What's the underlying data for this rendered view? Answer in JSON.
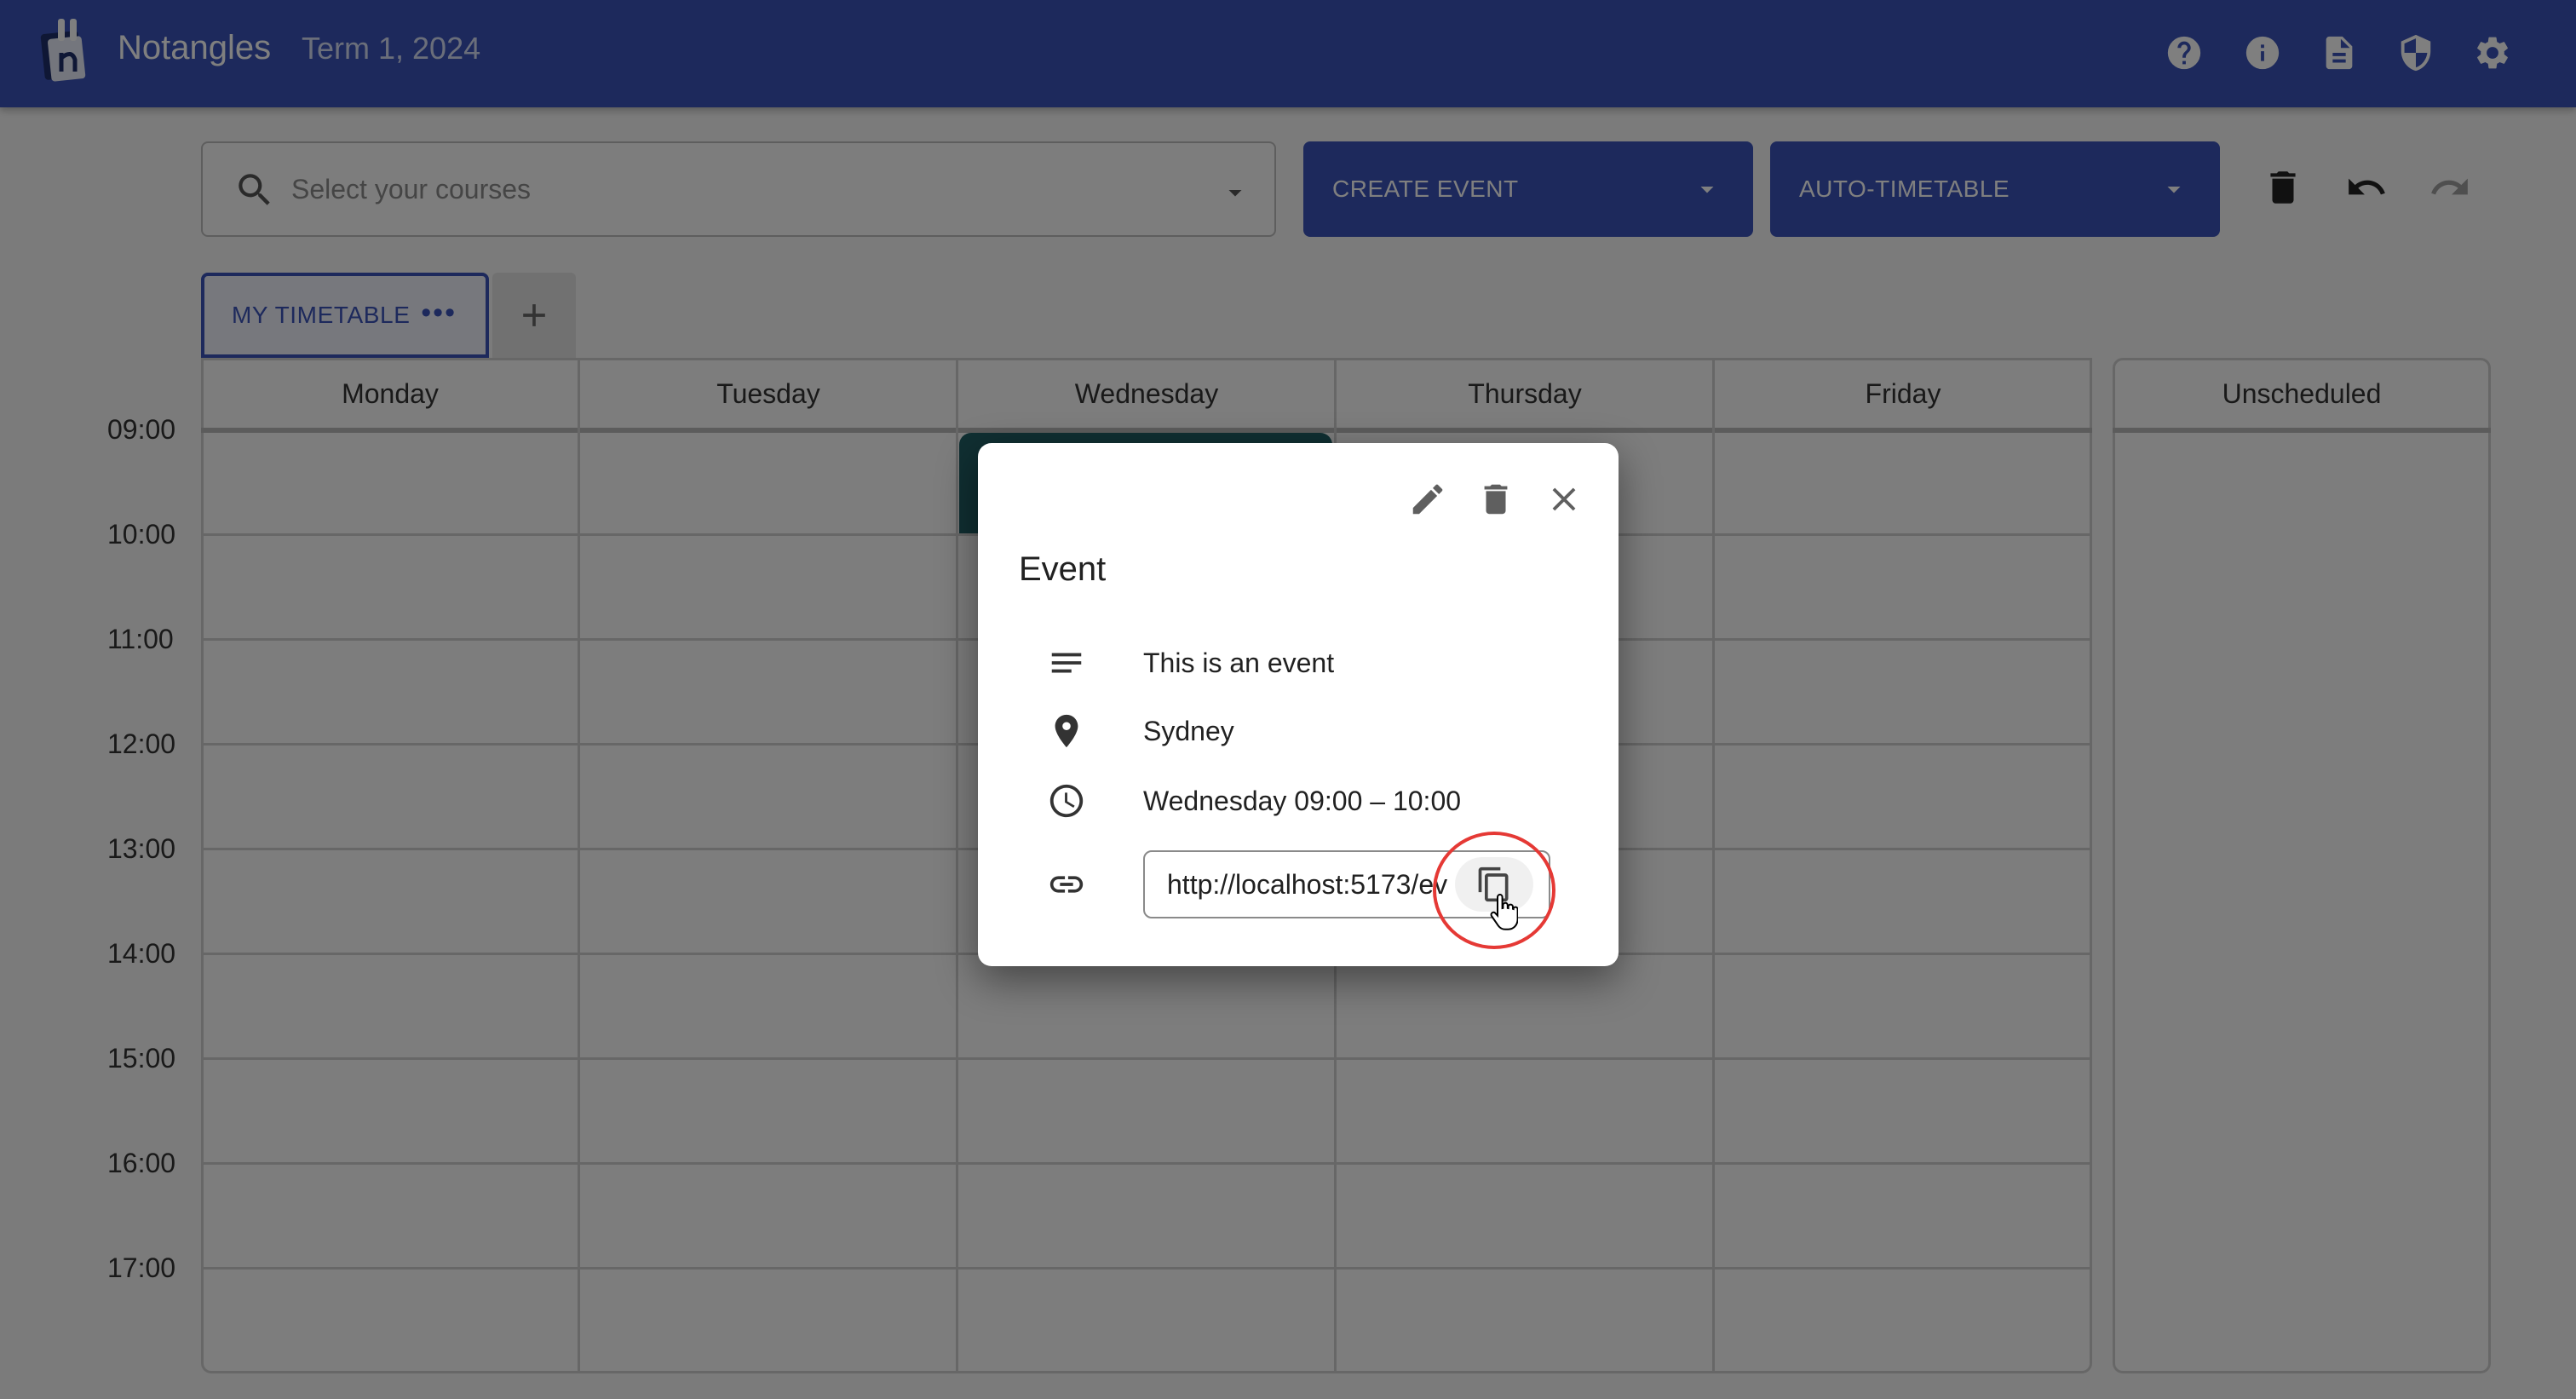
{
  "header": {
    "app_name": "Notangles",
    "term": "Term 1, 2024",
    "icons": [
      "help-icon",
      "info-icon",
      "document-icon",
      "shield-icon",
      "gear-icon"
    ]
  },
  "controls": {
    "course_select_placeholder": "Select your courses",
    "create_event_label": "CREATE EVENT",
    "auto_timetable_label": "AUTO-TIMETABLE",
    "tool_icons": [
      "delete-icon",
      "undo-icon",
      "redo-icon"
    ]
  },
  "tabs": {
    "active_label": "MY TIMETABLE",
    "more_label": "•••"
  },
  "timetable": {
    "days": [
      "Monday",
      "Tuesday",
      "Wednesday",
      "Thursday",
      "Friday"
    ],
    "unscheduled_label": "Unscheduled",
    "times": [
      "09:00",
      "10:00",
      "11:00",
      "12:00",
      "13:00",
      "14:00",
      "15:00",
      "16:00",
      "17:00"
    ]
  },
  "dialog": {
    "title": "Event",
    "description": "This is an event",
    "location": "Sydney",
    "time": "Wednesday 09:00 – 10:00",
    "link": "http://localhost:5173/ev"
  },
  "colors": {
    "brand": "#3a53b8",
    "event": "#215f64",
    "highlight": "#e53935"
  }
}
